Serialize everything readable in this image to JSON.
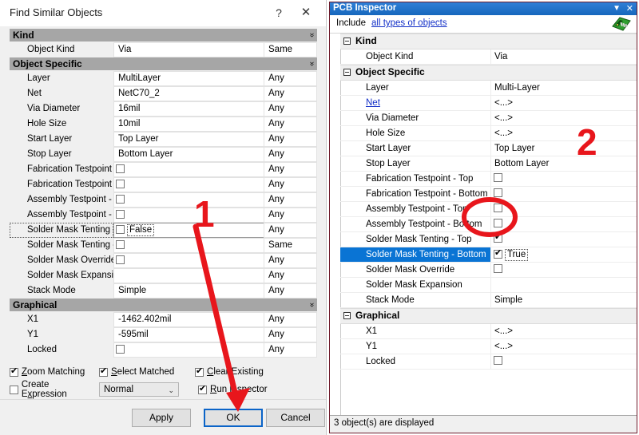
{
  "find_similar": {
    "title": "Find Similar Objects",
    "help_icon": "?",
    "close_icon": "✕",
    "sections": [
      {
        "name": "Kind",
        "rows": [
          {
            "label": "Object Kind",
            "value": "Via",
            "type": "text",
            "condition": "Same"
          }
        ]
      },
      {
        "name": "Object Specific",
        "rows": [
          {
            "label": "Layer",
            "value": "MultiLayer",
            "type": "text",
            "condition": "Any"
          },
          {
            "label": "Net",
            "value": "NetC70_2",
            "type": "text",
            "condition": "Any"
          },
          {
            "label": "Via Diameter",
            "value": "16mil",
            "type": "text",
            "condition": "Any"
          },
          {
            "label": "Hole Size",
            "value": "10mil",
            "type": "text",
            "condition": "Any"
          },
          {
            "label": "Start Layer",
            "value": "Top Layer",
            "type": "text",
            "condition": "Any"
          },
          {
            "label": "Stop Layer",
            "value": "Bottom Layer",
            "type": "text",
            "condition": "Any"
          },
          {
            "label": "Fabrication Testpoint - T",
            "value": "",
            "type": "checkbox",
            "checked": false,
            "condition": "Any"
          },
          {
            "label": "Fabrication Testpoint - B",
            "value": "",
            "type": "checkbox",
            "checked": false,
            "condition": "Any"
          },
          {
            "label": "Assembly Testpoint - Top",
            "value": "",
            "type": "checkbox",
            "checked": false,
            "condition": "Any"
          },
          {
            "label": "Assembly Testpoint - Bot",
            "value": "",
            "type": "checkbox",
            "checked": false,
            "condition": "Any"
          },
          {
            "label": "Solder Mask Tenting - T",
            "value": "False",
            "type": "checkbox-edit",
            "checked": false,
            "condition": "Any",
            "focused": true
          },
          {
            "label": "Solder Mask Tenting - B",
            "value": "",
            "type": "checkbox",
            "checked": false,
            "condition": "Same"
          },
          {
            "label": "Solder Mask Override",
            "value": "",
            "type": "checkbox",
            "checked": false,
            "condition": "Any"
          },
          {
            "label": "Solder Mask Expansion",
            "value": "",
            "type": "text",
            "condition": "Any"
          },
          {
            "label": "Stack Mode",
            "value": "Simple",
            "type": "text",
            "condition": "Any"
          }
        ]
      },
      {
        "name": "Graphical",
        "rows": [
          {
            "label": "X1",
            "value": "-1462.402mil",
            "type": "text",
            "condition": "Any"
          },
          {
            "label": "Y1",
            "value": "-595mil",
            "type": "text",
            "condition": "Any"
          },
          {
            "label": "Locked",
            "value": "",
            "type": "checkbox",
            "checked": false,
            "condition": "Any"
          }
        ]
      }
    ],
    "options": {
      "zoom_matching": {
        "label": "Zoom Matching",
        "accel": "Z",
        "checked": true
      },
      "select_matched": {
        "label": "Select Matched",
        "accel": "S",
        "checked": true
      },
      "clear_existing": {
        "label": "Clear Existing",
        "accel": "C",
        "checked": true
      },
      "create_expression": {
        "label": "Create Expression",
        "accel": "x",
        "checked": false
      },
      "run_inspector": {
        "label": "Run Inspector",
        "accel": "R",
        "checked": true
      },
      "mode_select": {
        "value": "Normal",
        "chevron": "⌄"
      }
    },
    "buttons": {
      "apply": "Apply",
      "ok": "OK",
      "cancel": "Cancel"
    }
  },
  "pcb_inspector": {
    "title": "PCB Inspector",
    "minimize_icon": "▼",
    "close_icon": "✕",
    "include_label": "Include",
    "include_link": "all types of objects",
    "board_icon": "pcb-board-icon",
    "sections": [
      {
        "name": "Kind",
        "rows": [
          {
            "label": "Object Kind",
            "value": "Via",
            "type": "text"
          }
        ]
      },
      {
        "name": "Object Specific",
        "rows": [
          {
            "label": "Layer",
            "value": "Multi-Layer",
            "type": "text"
          },
          {
            "label": "Net",
            "value": "<...>",
            "type": "text",
            "link": true
          },
          {
            "label": "Via Diameter",
            "value": "<...>",
            "type": "text"
          },
          {
            "label": "Hole Size",
            "value": "<...>",
            "type": "text"
          },
          {
            "label": "Start Layer",
            "value": "Top Layer",
            "type": "text"
          },
          {
            "label": "Stop Layer",
            "value": "Bottom Layer",
            "type": "text"
          },
          {
            "label": "Fabrication Testpoint - Top",
            "value": "",
            "type": "checkbox",
            "checked": false
          },
          {
            "label": "Fabrication Testpoint - Bottom",
            "value": "",
            "type": "checkbox",
            "checked": false
          },
          {
            "label": "Assembly Testpoint - Top",
            "value": "",
            "type": "checkbox",
            "checked": false
          },
          {
            "label": "Assembly Testpoint - Bottom",
            "value": "",
            "type": "checkbox",
            "checked": false
          },
          {
            "label": "Solder Mask Tenting - Top",
            "value": "",
            "type": "checkbox",
            "checked": true
          },
          {
            "label": "Solder Mask Tenting - Bottom",
            "value": "True",
            "type": "checkbox-edit",
            "checked": true,
            "selected": true
          },
          {
            "label": "Solder Mask Override",
            "value": "",
            "type": "checkbox",
            "checked": false
          },
          {
            "label": "Solder Mask Expansion",
            "value": "",
            "type": "text"
          },
          {
            "label": "Stack Mode",
            "value": "Simple",
            "type": "text"
          }
        ]
      },
      {
        "name": "Graphical",
        "rows": [
          {
            "label": "X1",
            "value": "<...>",
            "type": "text"
          },
          {
            "label": "Y1",
            "value": "<...>",
            "type": "text"
          },
          {
            "label": "Locked",
            "value": "",
            "type": "checkbox",
            "checked": false
          }
        ]
      }
    ],
    "status": "3 object(s) are displayed"
  },
  "annotations": {
    "marker_1": "1",
    "marker_2": "2",
    "color": "#e8161c"
  }
}
